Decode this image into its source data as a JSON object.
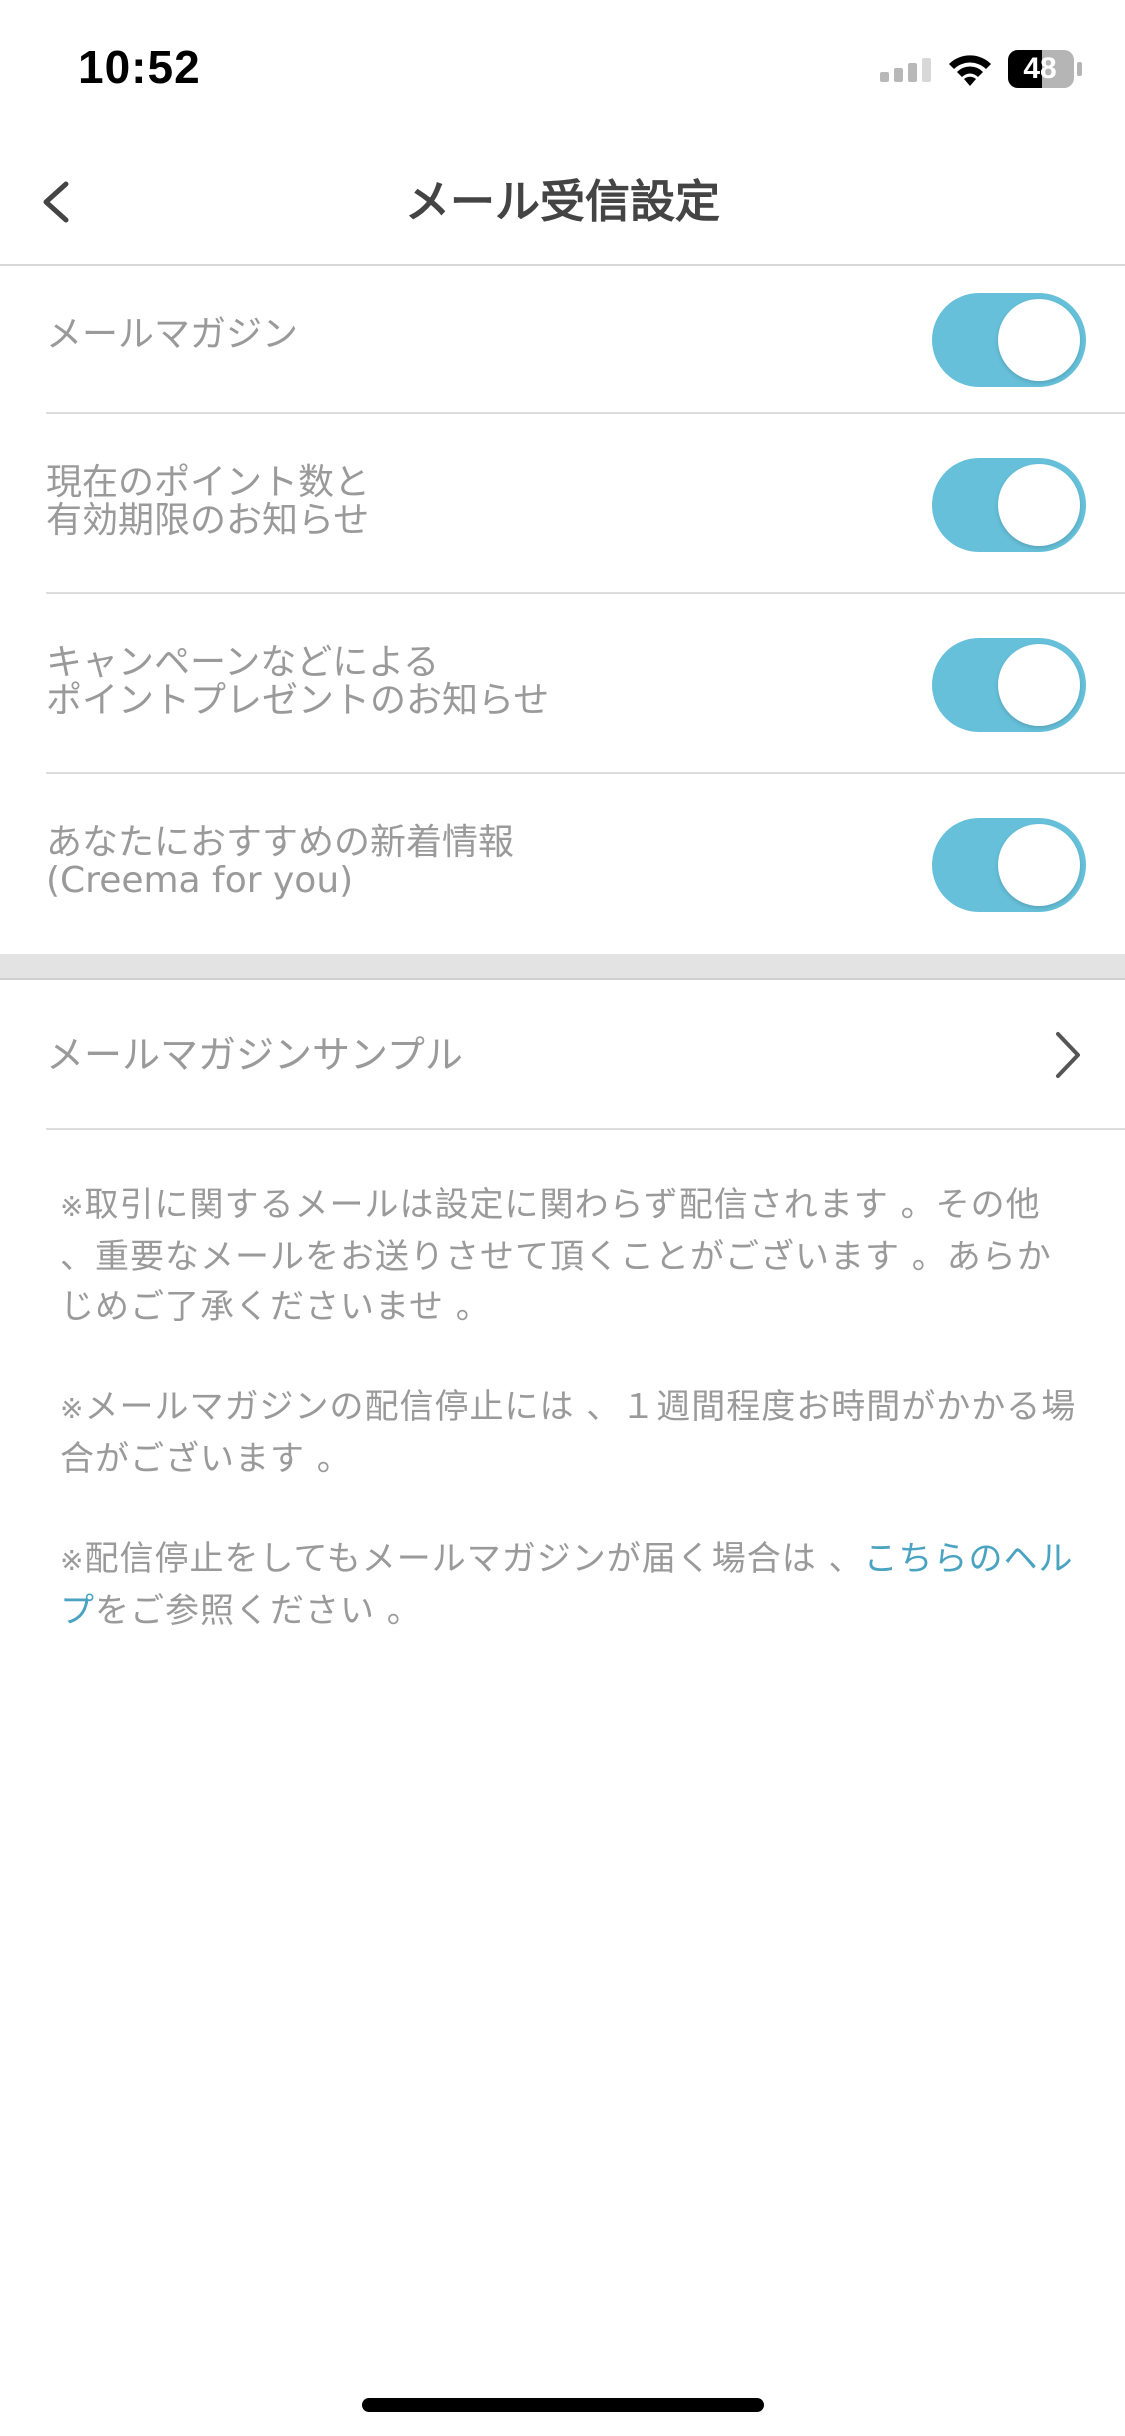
{
  "status_bar": {
    "time": "10:52",
    "battery_level": "48",
    "icons": [
      "signal-icon",
      "wifi-icon",
      "battery-icon"
    ]
  },
  "nav": {
    "title": "メール受信設定",
    "back_icon": "chevron-left-icon"
  },
  "settings": [
    {
      "label": "メールマガジン",
      "enabled": true
    },
    {
      "label": "現在のポイント数と\n有効期限のお知らせ",
      "enabled": true
    },
    {
      "label": "キャンペーンなどによる\nポイントプレゼントのお知らせ",
      "enabled": true
    },
    {
      "label": "あなたにおすすめの新着情報\n(Creema for you)",
      "enabled": true
    }
  ],
  "sample_link": {
    "label": "メールマガジンサンプル",
    "icon": "chevron-right-icon"
  },
  "notes": {
    "mark": "※",
    "note1": "取引に関するメールは設定に関わらず配信されます 。その他 、重要なメールをお送りさせて頂くことがございます 。あらかじめご了承くださいませ 。",
    "note2": "メールマガジンの配信停止には 、１週間程度お時間がかかる場合がございます 。",
    "note3_before": "配信停止をしてもメールマガジンが届く場合は 、",
    "note3_link": "こちらのヘルプ",
    "note3_after": "をご参照ください 。"
  },
  "colors": {
    "toggle_on": "#66c0da",
    "link": "#4aa3c0",
    "label_text": "#9a9a9a",
    "title_text": "#444444"
  }
}
